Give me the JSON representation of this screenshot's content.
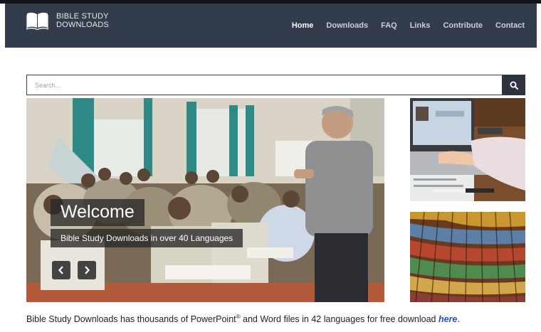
{
  "header": {
    "logo_line1": "BIBLE STUDY",
    "logo_line2": "DOWNLOADS",
    "nav": [
      "Home",
      "Downloads",
      "FAQ",
      "Links",
      "Contribute",
      "Contact"
    ],
    "active_nav": "Home"
  },
  "search": {
    "placeholder": "Search..."
  },
  "slider": {
    "title": "Welcome",
    "subtitle": "Bible Study Downloads in over 40 Languages"
  },
  "intro": {
    "text_before": "Bible Study Downloads has thousands of PowerPoint",
    "registered": "®",
    "text_after": " and Word files in 42 languages for free download ",
    "link_text": "here",
    "period": "."
  },
  "colors": {
    "navbar": "#333c4b",
    "nav_active": "#ffffff",
    "link": "#1f4fd1",
    "search_button": "#2d3440"
  }
}
